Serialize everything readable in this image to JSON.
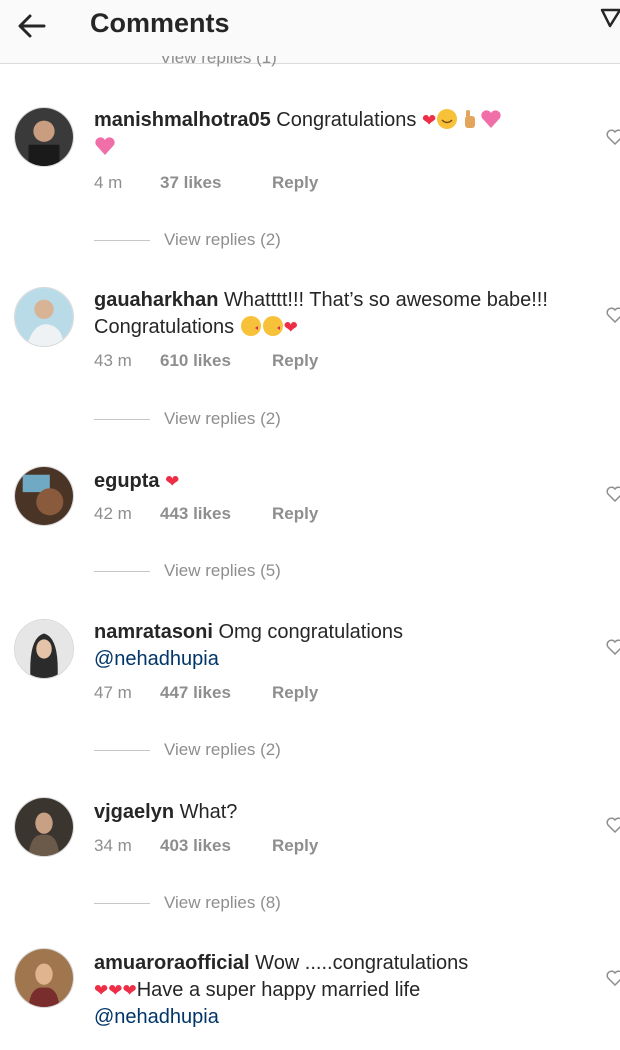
{
  "header": {
    "title": "Comments"
  },
  "top_replies_label": "View replies (1)",
  "comments": [
    {
      "username": "manishmalhotra05",
      "text": "Congratulations",
      "time": "4 m",
      "likes": "37 likes",
      "reply": "Reply",
      "view_replies": "View replies (2)"
    },
    {
      "username": "gauaharkhan",
      "text": "Whatttt!!! That’s so awesome babe!!! Congratulations",
      "time": "43 m",
      "likes": "610 likes",
      "reply": "Reply",
      "view_replies": "View replies (2)"
    },
    {
      "username": "egupta",
      "text": "",
      "time": "42 m",
      "likes": "443 likes",
      "reply": "Reply",
      "view_replies": "View replies (5)"
    },
    {
      "username": "namratasoni",
      "text": "Omg congratulations",
      "mention": "@nehadhupia",
      "time": "47 m",
      "likes": "447 likes",
      "reply": "Reply",
      "view_replies": "View replies (2)"
    },
    {
      "username": "vjgaelyn",
      "text": "What?",
      "time": "34 m",
      "likes": "403 likes",
      "reply": "Reply",
      "view_replies": "View replies (8)"
    },
    {
      "username": "amuaroraofficial",
      "text": "Wow .....congratulations",
      "text2": "Have a super happy married life",
      "mention": "@nehadhupia"
    }
  ],
  "colors": {
    "heart": "#ed2e46",
    "mention": "#003569",
    "meta": "#8e8e8e"
  }
}
